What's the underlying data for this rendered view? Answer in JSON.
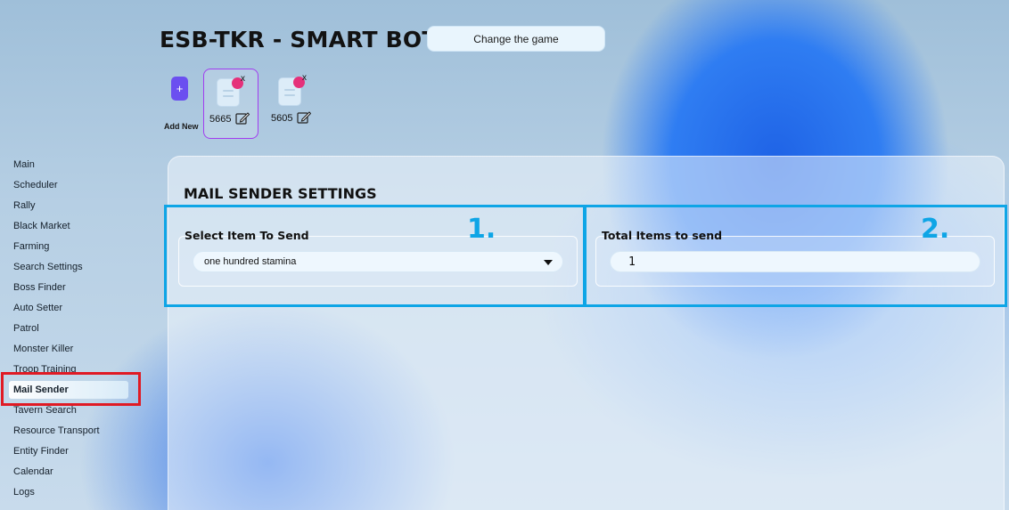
{
  "header": {
    "title": "ESB-TKR - SMART BOT",
    "change_game_label": "Change the game"
  },
  "profiles": {
    "add_symbol": "+",
    "add_label": "Add New",
    "close_symbol": "x",
    "items": [
      {
        "id": "5665",
        "active": true
      },
      {
        "id": "5605",
        "active": false
      }
    ]
  },
  "sidebar": {
    "items": [
      {
        "label": "Main"
      },
      {
        "label": "Scheduler"
      },
      {
        "label": "Rally"
      },
      {
        "label": "Black Market"
      },
      {
        "label": "Farming"
      },
      {
        "label": "Search Settings"
      },
      {
        "label": "Boss Finder"
      },
      {
        "label": "Auto Setter"
      },
      {
        "label": "Patrol"
      },
      {
        "label": "Monster Killer"
      },
      {
        "label": "Troop Training"
      },
      {
        "label": "Mail Sender",
        "active": true
      },
      {
        "label": "Tavern Search"
      },
      {
        "label": "Resource Transport"
      },
      {
        "label": "Entity Finder"
      },
      {
        "label": "Calendar"
      },
      {
        "label": "Logs"
      }
    ]
  },
  "main": {
    "section_title": "MAIL SENDER SETTINGS",
    "select_item": {
      "label": "Select Item To Send",
      "value": "one hundred stamina",
      "step": "1."
    },
    "total_items": {
      "label": "Total Items to send",
      "value": "1",
      "step": "2."
    }
  },
  "colors": {
    "accent_purple": "#6b4ff0",
    "active_profile_border": "#a13cf0",
    "annotation_blue": "#0ea5e6",
    "annotation_red": "#e01a24",
    "badge_pink": "#e5307a"
  }
}
